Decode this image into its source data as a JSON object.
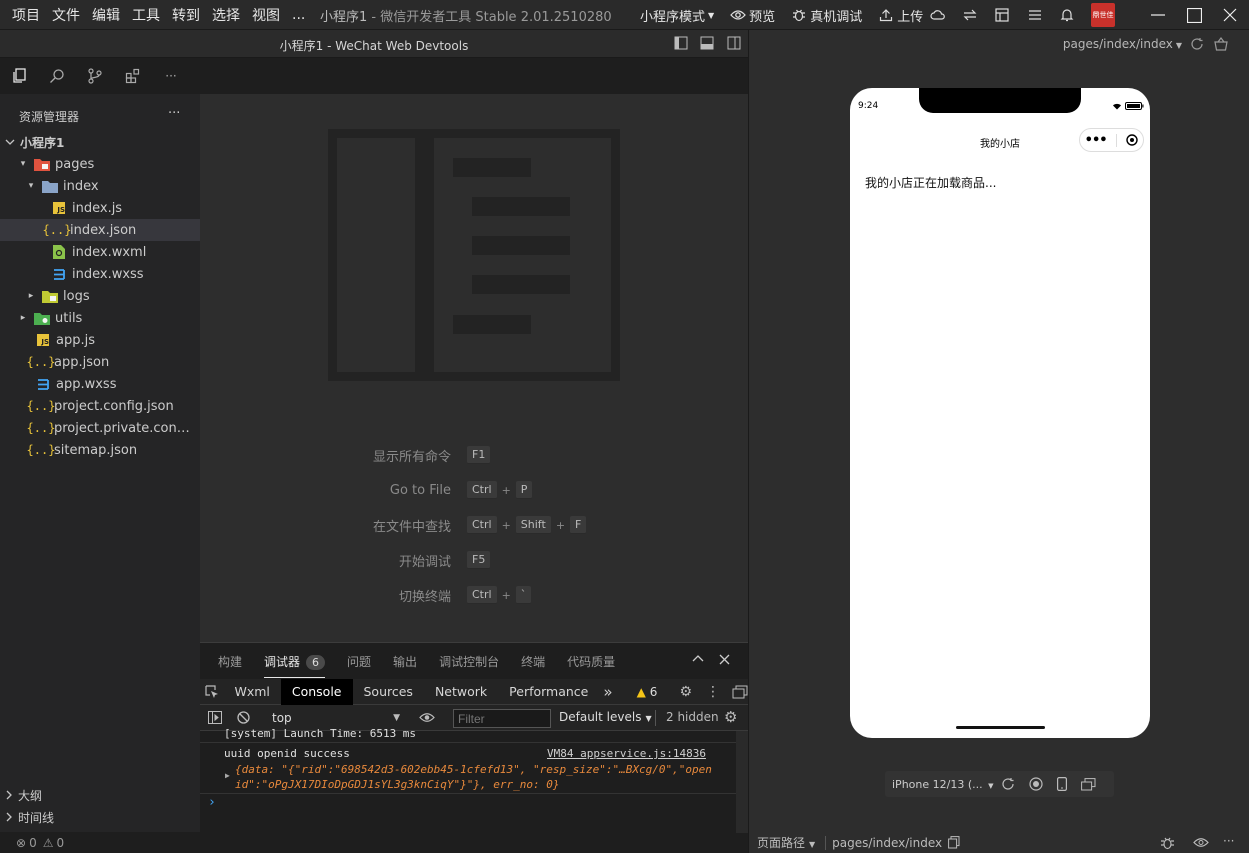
{
  "menubar": {
    "menus": [
      "项目",
      "文件",
      "编辑",
      "工具",
      "转到",
      "选择",
      "视图",
      "..."
    ],
    "title_main": "小程序1",
    "title_sep": " - ",
    "title_app": "微信开发者工具 Stable 2.01.2510280",
    "mode": "小程序模式",
    "preview": "预览",
    "real_debug": "真机调试",
    "upload": "上传",
    "avatar_text": "鼎世佳"
  },
  "editor": {
    "window_title": "小程序1 - WeChat Web Devtools"
  },
  "sidebar": {
    "header": "资源管理器",
    "more": "···",
    "root": "小程序1",
    "tree": [
      {
        "label": "pages",
        "type": "folder-pages",
        "expanded": true
      },
      {
        "label": "index",
        "type": "folder",
        "expanded": true
      },
      {
        "label": "index.js",
        "type": "js"
      },
      {
        "label": "index.json",
        "type": "json",
        "selected": true
      },
      {
        "label": "index.wxml",
        "type": "wxml"
      },
      {
        "label": "index.wxss",
        "type": "wxss"
      },
      {
        "label": "logs",
        "type": "folder",
        "expanded": false
      },
      {
        "label": "utils",
        "type": "folder-utils",
        "expanded": false
      },
      {
        "label": "app.js",
        "type": "js"
      },
      {
        "label": "app.json",
        "type": "json"
      },
      {
        "label": "app.wxss",
        "type": "wxss"
      },
      {
        "label": "project.config.json",
        "type": "json"
      },
      {
        "label": "project.private.config.js...",
        "type": "json"
      },
      {
        "label": "sitemap.json",
        "type": "json"
      }
    ],
    "outline": "大纲",
    "timeline": "时间线",
    "errors": "0",
    "warnings": "0"
  },
  "welcome": {
    "shortcuts": [
      {
        "desc": "显示所有命令",
        "keys": [
          "F1"
        ]
      },
      {
        "desc": "Go to File",
        "keys": [
          "Ctrl",
          "P"
        ]
      },
      {
        "desc": "在文件中查找",
        "keys": [
          "Ctrl",
          "Shift",
          "F"
        ]
      },
      {
        "desc": "开始调试",
        "keys": [
          "F5"
        ]
      },
      {
        "desc": "切换终端",
        "keys": [
          "Ctrl",
          "`"
        ]
      }
    ]
  },
  "panel": {
    "tabs": [
      "构建",
      "调试器",
      "问题",
      "输出",
      "调试控制台",
      "终端",
      "代码质量"
    ],
    "active_tab": "调试器",
    "debugger_badge": "6",
    "devtools_tabs": [
      "Wxml",
      "Console",
      "Sources",
      "Network",
      "Performance"
    ],
    "active_devtools_tab": "Console",
    "more_tabs": "»",
    "warn_count": "6",
    "context": "top",
    "filter_placeholder": "Filter",
    "levels": "Default levels",
    "hidden": "2 hidden",
    "console": {
      "line1": "[system] Launch Time: 6513 ms",
      "line2": "uuid openid success",
      "source": "VM84 appservice.js:14836",
      "obj_line1": "{data: \"{\"rid\":\"698542d3-602ebb45-1cfefd13\", \"resp_size\":\"…BXcg/0\",\"open",
      "obj_line2": "id\":\"oPgJX17DIoDpGDJ1sYL3g3knCiqY\"}\"}, err_no: 0}",
      "prompt": "›"
    }
  },
  "simulator": {
    "page_path": "pages/index/index",
    "time": "9:24",
    "nav_title": "我的小店",
    "content": "我的小店正在加载商品...",
    "device": "iPhone 12/13 (... ",
    "status_label": "页面路径",
    "status_path": "pages/index/index"
  },
  "colors": {
    "accent_blue": "#42a5f5",
    "warning_yellow": "#f5c518",
    "folder_pages": "#e0533f",
    "folder_utils": "#4caf50"
  }
}
